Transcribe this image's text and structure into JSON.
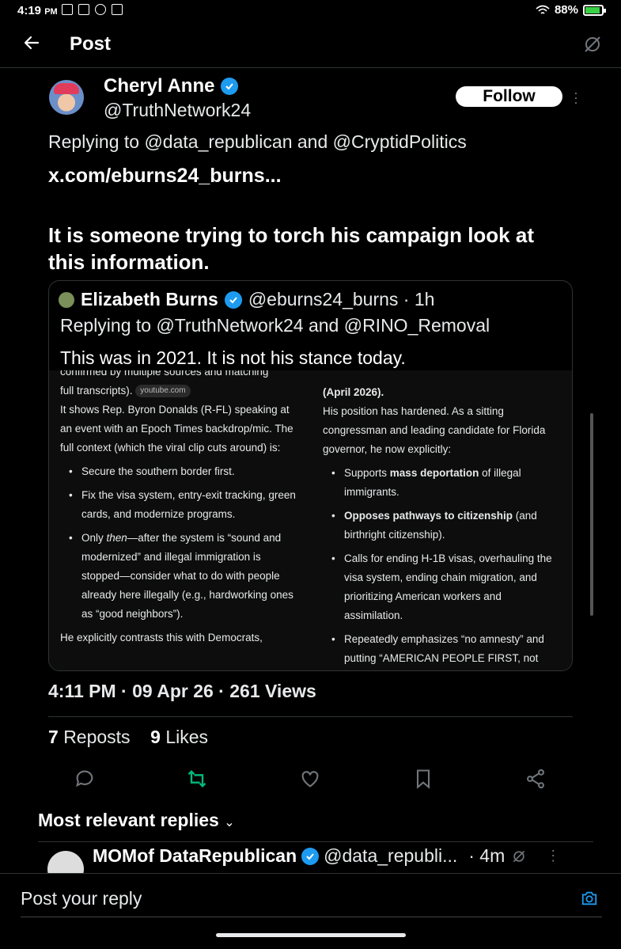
{
  "status_bar": {
    "time": "4:19",
    "ampm": "PM",
    "battery": "88%",
    "battery_level": 0.88
  },
  "header": {
    "title": "Post"
  },
  "post": {
    "author_name": "Cheryl Anne",
    "author_handle": "@TruthNetwork24",
    "follow_label": "Follow",
    "replying_to": "Replying to @data_republican and @CryptidPolitics",
    "link": "x.com/eburns24_burns...",
    "text": "It is someone trying to torch his campaign look at this information.",
    "meta": "4:11 PM · 09 Apr 26 · 261 Views",
    "reposts_count": "7",
    "reposts_label": "Reposts",
    "likes_count": "9",
    "likes_label": "Likes"
  },
  "quote": {
    "author_name": "Elizabeth Burns",
    "meta": "@eburns24_burns · 1h",
    "replying_to": "Replying to @TruthNetwork24 and @RINO_Removal",
    "text": "This was in 2021. It is not his stance today.",
    "image": {
      "col1_lines": [
        "confirmed by multiple sources and matching",
        "full transcripts).",
        "It shows Rep. Byron Donalds (R-FL) speaking at an event with an Epoch Times backdrop/mic. The full context (which the viral clip cuts around) is:"
      ],
      "chip": "youtube.com",
      "col1_items": [
        "Secure the southern border first.",
        "Fix the visa system, entry-exit tracking, green cards, and modernize programs.",
        "Only then—after the system is “sound and modernized” and illegal immigration is stopped—consider what to do with people already here illegally (e.g., hardworking ones as “good neighbors”)."
      ],
      "col1_tail": "He explicitly contrasts this with Democrats,",
      "col2_heading": "(April 2026).",
      "col2_intro": "His position has hardened. As a sitting congressman and leading candidate for Florida governor, he now explicitly:",
      "col2_items": [
        {
          "strong": "",
          "pre": "Supports ",
          "bold": "mass deportation",
          "post": " of illegal immigrants."
        },
        {
          "pre": "",
          "bold": "Opposes pathways to citizenship",
          "post": " (and birthright citizenship)."
        },
        {
          "pre": "Calls for ending H-1B visas, overhauling the visa system, ending chain migration, and prioritizing American workers and assimilation.",
          "bold": "",
          "post": ""
        },
        {
          "pre": "Repeatedly emphasizes “no amnesty” and putting “AMERICAN PEOPLE FIRST, not",
          "bold": "",
          "post": ""
        }
      ]
    }
  },
  "replies": {
    "section_label": "Most relevant replies",
    "first_reply": {
      "author_name": "MOMof DataRepublican",
      "handle": "@data_republi...",
      "time": "· 4m"
    }
  },
  "composer": {
    "placeholder": "Post your reply"
  },
  "colors": {
    "accent": "#1d9bf0",
    "repost_active": "#00ba7c",
    "background": "#000000"
  }
}
